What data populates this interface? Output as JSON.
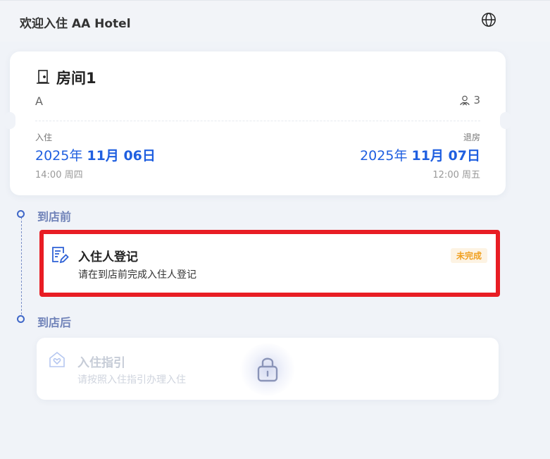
{
  "header": {
    "welcome": "欢迎入住 AA Hotel",
    "language_icon": "globe-icon"
  },
  "room": {
    "title": "房间1",
    "subtitle": "A",
    "guests": "3",
    "checkin": {
      "label": "入住",
      "year": "2025年 ",
      "date": "11月 06日",
      "time": "14:00 周四"
    },
    "checkout": {
      "label": "退房",
      "year": "2025年 ",
      "date": "11月 07日",
      "time": "12:00 周五"
    }
  },
  "timeline": {
    "before": "到店前",
    "after": "到店后"
  },
  "tasks": {
    "registration": {
      "title": "入住人登记",
      "desc": "请在到店前完成入住人登记",
      "status": "未完成"
    },
    "guide": {
      "title": "入住指引",
      "desc": "请按照入住指引办理入住"
    }
  },
  "colors": {
    "accent": "#1f5fe0",
    "highlight_border": "#e81d24",
    "badge_text": "#f0a020",
    "timeline": "#6f82b8"
  }
}
